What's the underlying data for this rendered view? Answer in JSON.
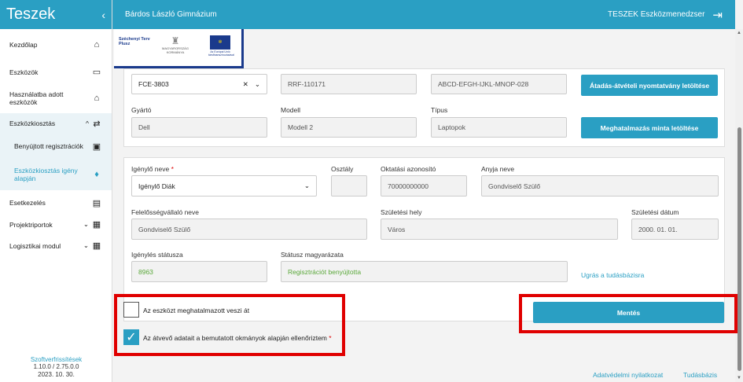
{
  "sidebar": {
    "title": "Teszek",
    "items": [
      {
        "label": "Kezdőlap",
        "icon": "home-icon",
        "glyph": "⌂"
      },
      {
        "label": "Eszközök",
        "icon": "laptop-icon",
        "glyph": "▭"
      },
      {
        "label": "Használatba adott eszközök",
        "icon": "handover-icon",
        "glyph": "⌂"
      },
      {
        "label": "Eszközkiosztás",
        "icon": "distribution-icon",
        "glyph": "⇄"
      },
      {
        "label": "Benyújtott regisztrációk",
        "icon": "inbox-icon",
        "glyph": "▣"
      },
      {
        "label": "Eszközkiosztás igény alapján",
        "icon": "bulb-icon",
        "glyph": "♦"
      },
      {
        "label": "Esetkezelés",
        "icon": "clipboard-icon",
        "glyph": "▤"
      },
      {
        "label": "Projektriportok",
        "icon": "report-icon",
        "glyph": "▦"
      },
      {
        "label": "Logisztikai modul",
        "icon": "logistics-icon",
        "glyph": "▦"
      }
    ],
    "footer": {
      "link": "Szoftverfrissítések",
      "version": "1.10.0 / 2.75.0.0",
      "date": "2023. 10. 30."
    }
  },
  "topbar": {
    "school": "Bárdos László Gimnázium",
    "app": "TESZEK Eszközmenedzser"
  },
  "logo": {
    "line1": "Széchenyi Terv",
    "line2": "Plusz",
    "line3": "MAGYARORSZÁG KORMÁNYA",
    "line4": "Az Európai Unió társfinanszírozásával"
  },
  "device": {
    "id_value": "FCE-3803",
    "serial": "RRF-110171",
    "code": "ABCD-EFGH-IJKL-MNOP-028",
    "btn_handover": "Átadás-átvételi nyomtatvány letöltése",
    "manufacturer_label": "Gyártó",
    "manufacturer": "Dell",
    "model_label": "Modell",
    "model": "Modell 2",
    "type_label": "Típus",
    "type": "Laptopok",
    "btn_authorization": "Meghatalmazás minta letöltése"
  },
  "requester": {
    "name_label": "Igénylő neve",
    "name": "Igénylő Diák",
    "class_label": "Osztály",
    "class": "",
    "edu_id_label": "Oktatási azonosító",
    "edu_id": "70000000000",
    "mother_label": "Anyja neve",
    "mother": "Gondviselő Szülő",
    "guardian_label": "Felelősségvállaló neve",
    "guardian": "Gondviselő Szülő",
    "birthplace_label": "Születési hely",
    "birthplace": "Város",
    "birthdate_label": "Születési dátum",
    "birthdate": "2000. 01. 01.",
    "status_label": "Igénylés státusza",
    "status": "8963",
    "status_desc_label": "Státusz magyarázata",
    "status_desc": "Regisztrációt benyújtotta",
    "kb_link": "Ugrás a tudásbázisra"
  },
  "confirm": {
    "cb1": "Az eszközt meghatalmazott veszi át",
    "cb1_checked": false,
    "cb2": "Az átvevő adatait a bemutatott okmányok alapján ellenőriztem",
    "cb2_checked": true,
    "save": "Mentés"
  },
  "footer": {
    "privacy": "Adatvédelmi nyilatkozat",
    "kb": "Tudásbázis"
  },
  "colors": {
    "accent": "#2a9fc3",
    "highlight": "#e00000"
  }
}
